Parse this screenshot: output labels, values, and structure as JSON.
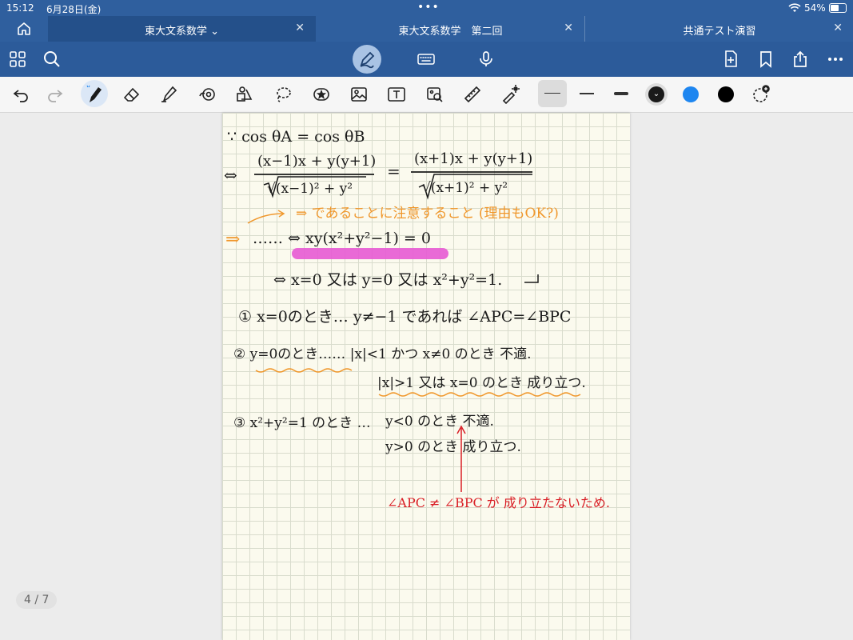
{
  "status": {
    "time": "15:12",
    "date": "6月28日(金)",
    "battery": "54%",
    "battery_level": 0.54
  },
  "tabs": [
    {
      "label": "東大文系数学",
      "active": true
    },
    {
      "label": "東大文系数学　第二回",
      "active": false
    },
    {
      "label": "共通テスト演習",
      "active": false
    }
  ],
  "navbar": {
    "left_icons": [
      "grid-icon",
      "search-icon"
    ],
    "center_icons": [
      "pen-mode-icon",
      "keyboard-icon",
      "microphone-icon"
    ],
    "right_icons": [
      "add-page-icon",
      "bookmark-icon",
      "share-icon",
      "more-icon"
    ]
  },
  "toolbar": {
    "tools": [
      "undo-icon",
      "redo-icon",
      "pen-icon",
      "eraser-icon",
      "highlighter-icon",
      "shapes-icon",
      "elements-icon",
      "lasso-icon",
      "sticker-icon",
      "image-icon",
      "text-icon",
      "scan-icon",
      "ruler-icon",
      "laser-pointer-icon"
    ],
    "colors": [
      "#1a1a1a",
      "#1e86f0",
      "#000000"
    ]
  },
  "note": {
    "lines": [
      {
        "text": "∵ cos θA = cos θB",
        "color": "black"
      },
      {
        "text": "⇔",
        "color": "black"
      },
      {
        "text": "(x−1)x + y(y+1)",
        "color": "black"
      },
      {
        "text": "=",
        "color": "black"
      },
      {
        "text": "(x+1)x + y(y+1)",
        "color": "black"
      },
      {
        "text": "√(x−1)² + y²",
        "color": "black"
      },
      {
        "text": "√(x+1)² + y²",
        "color": "black"
      },
      {
        "text": "⇒ であることに注意すること (理由もOK?)",
        "color": "orange"
      },
      {
        "text": "⇒",
        "color": "orange"
      },
      {
        "text": "…… ⇔ xy(x²+y²−1) = 0",
        "color": "black"
      },
      {
        "text": "⇔ x=0 又は y=0 又は x²+y²=1.",
        "color": "black"
      },
      {
        "text": "① x=0のとき… y≠−1 であれば ∠APC=∠BPC",
        "color": "black"
      },
      {
        "text": "② y=0のとき…… |x|<1 かつ x≠0 のとき 不適.",
        "color": "black"
      },
      {
        "text": "|x|>1 又は x=0 のとき 成り立つ.",
        "color": "black"
      },
      {
        "text": "③ x²+y²=1 のとき …",
        "color": "black"
      },
      {
        "text": "y<0 のとき 不適.",
        "color": "black"
      },
      {
        "text": "y>0 のとき 成り立つ.",
        "color": "black"
      },
      {
        "text": "∠APC ≠ ∠BPC が 成り立たないため.",
        "color": "red"
      }
    ]
  },
  "page_indicator": "4 / 7"
}
